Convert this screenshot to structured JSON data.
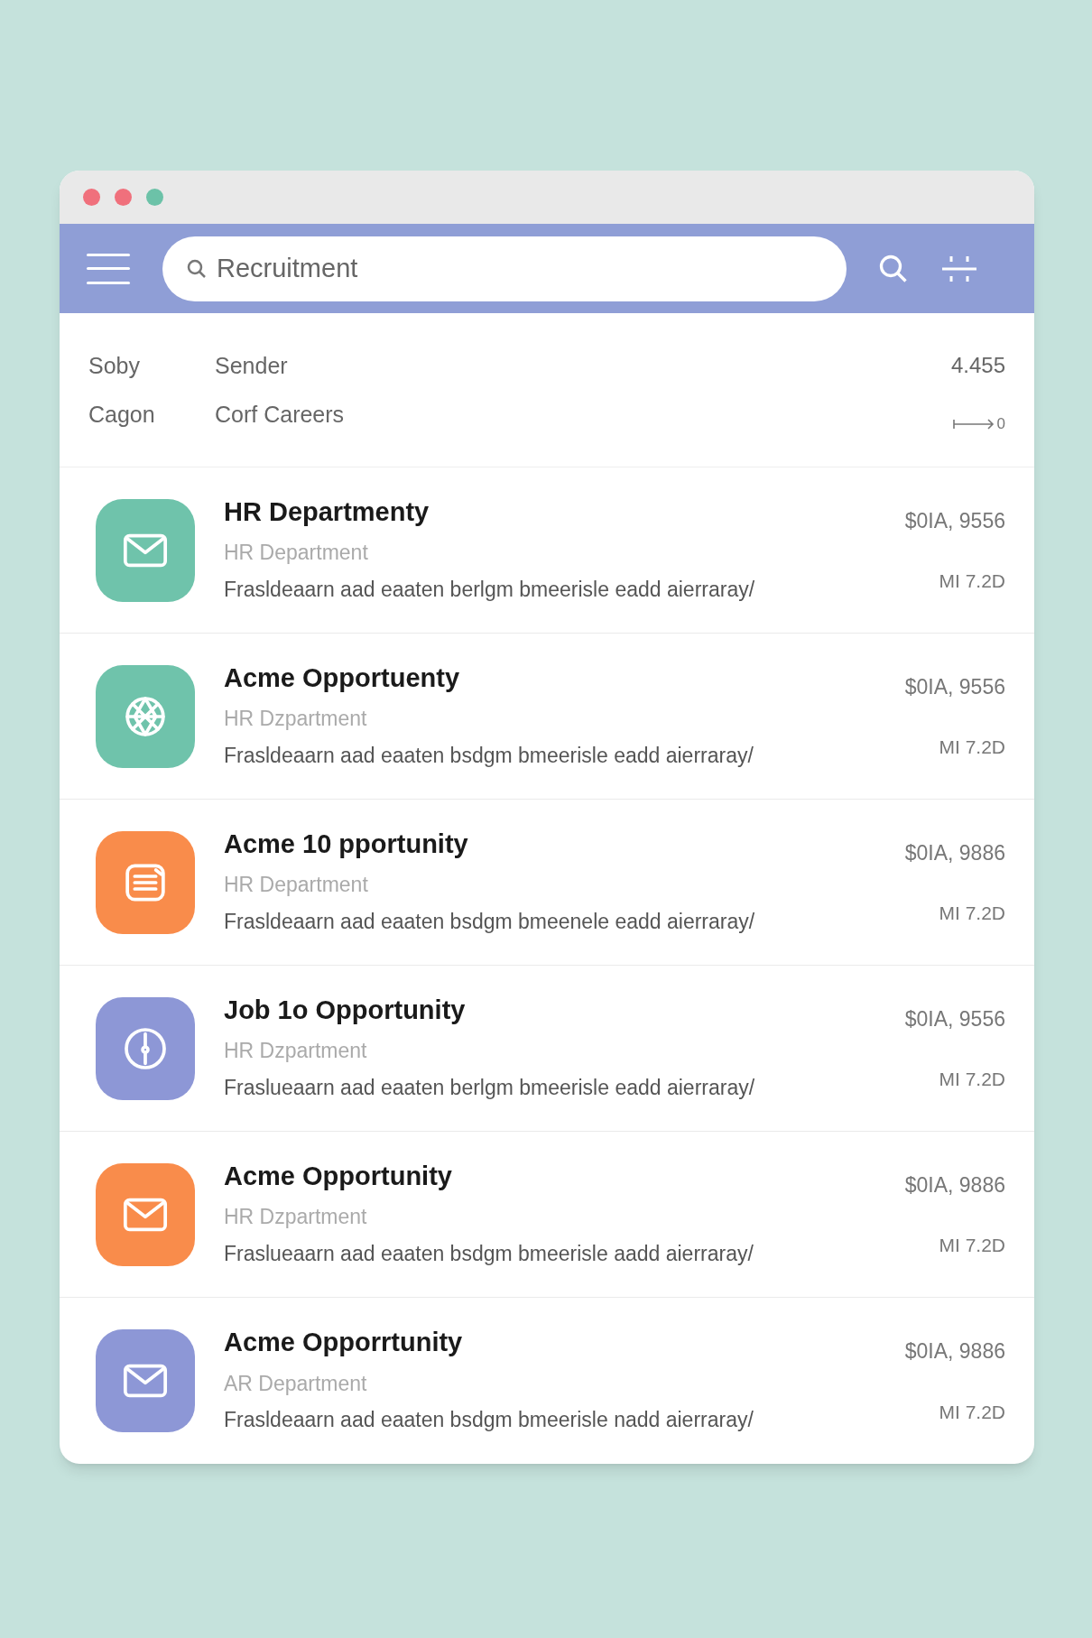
{
  "window": {
    "controls": [
      {
        "color": "#f0707c"
      },
      {
        "color": "#f0707c"
      },
      {
        "color": "#6cc2a8"
      }
    ]
  },
  "toolbar": {
    "search": {
      "value": "Recruitment"
    }
  },
  "header": {
    "labels": [
      [
        "Soby",
        "Sender"
      ],
      [
        "Cagon",
        "Corf Careers"
      ]
    ],
    "count": "4.455",
    "range_end": "0"
  },
  "messages": [
    {
      "kind": "mail",
      "color": "#6fc3ab",
      "title": "HR Departmenty",
      "subtitle": "HR Department",
      "preview": "Frasldeaarn aad eaaten berlgm bmeerisle eadd aierraray/",
      "amount": "$0IA, 9556",
      "date": "MI 7.2D"
    },
    {
      "kind": "globe",
      "color": "#6fc3ab",
      "title": "Acme Opportuenty",
      "subtitle": "HR Dzpartment",
      "preview": "Frasldeaarn aad eaaten bsdgm bmeerisle eadd aierraray/",
      "amount": "$0IA, 9556",
      "date": "MI 7.2D"
    },
    {
      "kind": "note",
      "color": "#f98c4b",
      "title": "Acme 10 pportunity",
      "subtitle": "HR Department",
      "preview": "Frasldeaarn aad eaaten bsdgm bmeenele eadd aierraray/",
      "amount": "$0IA, 9886",
      "date": "MI 7.2D"
    },
    {
      "kind": "compass",
      "color": "#8d97d6",
      "title": "Job 1o Opportunity",
      "subtitle": "HR Dzpartment",
      "preview": "Fraslueaarn aad eaaten berlgm bmeerisle eadd aierraray/",
      "amount": "$0IA, 9556",
      "date": "MI 7.2D"
    },
    {
      "kind": "mail",
      "color": "#f98c4b",
      "title": "Acme Opportunity",
      "subtitle": "HR Dzpartment",
      "preview": "Fraslueaarn aad eaaten bsdgm bmeerisle aadd aierraray/",
      "amount": "$0IA, 9886",
      "date": "MI 7.2D"
    },
    {
      "kind": "mail",
      "color": "#8d97d6",
      "title": "Acme Opporrtunity",
      "subtitle": "AR Department",
      "preview": "Frasldeaarn aad eaaten bsdgm bmeerisle nadd aierraray/",
      "amount": "$0IA, 9886",
      "date": "MI 7.2D"
    }
  ]
}
